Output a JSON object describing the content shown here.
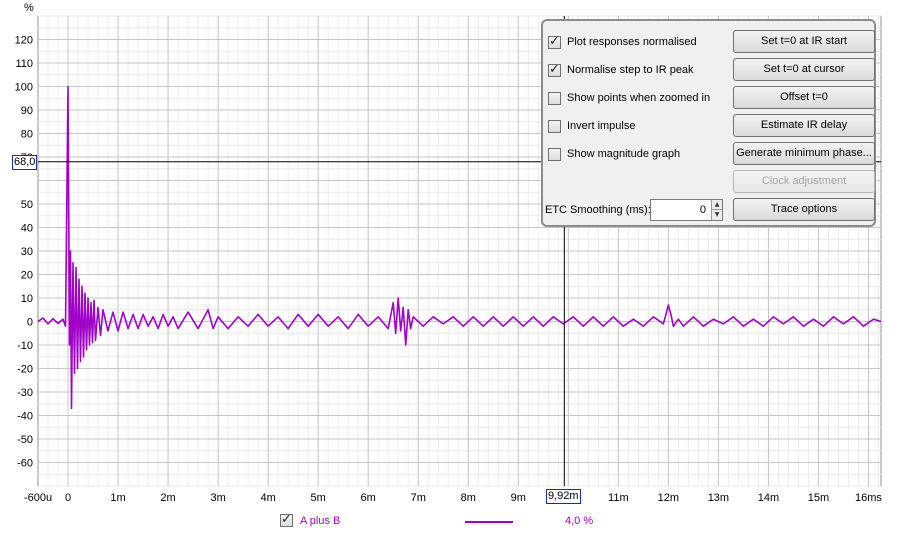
{
  "chart_data": {
    "type": "line",
    "ylabel": "%",
    "xlim_ms": [
      -0.6,
      16.25
    ],
    "ylim": [
      -70,
      130
    ],
    "x_ticks": [
      {
        "v": -0.6,
        "label": "-600u"
      },
      {
        "v": 0,
        "label": "0"
      },
      {
        "v": 1,
        "label": "1m"
      },
      {
        "v": 2,
        "label": "2m"
      },
      {
        "v": 3,
        "label": "3m"
      },
      {
        "v": 4,
        "label": "4m"
      },
      {
        "v": 5,
        "label": "5m"
      },
      {
        "v": 6,
        "label": "6m"
      },
      {
        "v": 7,
        "label": "7m"
      },
      {
        "v": 8,
        "label": "8m"
      },
      {
        "v": 9,
        "label": "9m"
      },
      {
        "v": 11,
        "label": "11m"
      },
      {
        "v": 12,
        "label": "12m"
      },
      {
        "v": 13,
        "label": "13m"
      },
      {
        "v": 14,
        "label": "14m"
      },
      {
        "v": 15,
        "label": "15m"
      },
      {
        "v": 16,
        "label": "16ms"
      }
    ],
    "y_ticks": [
      120,
      110,
      100,
      90,
      80,
      70,
      50,
      40,
      30,
      20,
      10,
      0,
      -10,
      -20,
      -30,
      -40,
      -50,
      -60
    ],
    "series": [
      {
        "name": "A plus B",
        "color": "#a100c8",
        "points": [
          [
            -0.6,
            0
          ],
          [
            -0.5,
            1.5
          ],
          [
            -0.4,
            -1
          ],
          [
            -0.3,
            1.2
          ],
          [
            -0.2,
            -0.8
          ],
          [
            -0.1,
            1
          ],
          [
            -0.05,
            -2
          ],
          [
            0,
            100
          ],
          [
            0.03,
            -10
          ],
          [
            0.05,
            30
          ],
          [
            0.07,
            -37
          ],
          [
            0.1,
            25
          ],
          [
            0.13,
            -22
          ],
          [
            0.16,
            23
          ],
          [
            0.19,
            -20
          ],
          [
            0.22,
            18
          ],
          [
            0.25,
            -17
          ],
          [
            0.28,
            15
          ],
          [
            0.31,
            -15
          ],
          [
            0.34,
            12
          ],
          [
            0.37,
            -12
          ],
          [
            0.4,
            10
          ],
          [
            0.43,
            -10
          ],
          [
            0.46,
            8
          ],
          [
            0.49,
            -9
          ],
          [
            0.52,
            9
          ],
          [
            0.55,
            -8
          ],
          [
            0.6,
            6
          ],
          [
            0.65,
            -6
          ],
          [
            0.7,
            5
          ],
          [
            0.8,
            -4
          ],
          [
            0.9,
            4
          ],
          [
            1.0,
            -4
          ],
          [
            1.1,
            4
          ],
          [
            1.2,
            -3
          ],
          [
            1.3,
            3
          ],
          [
            1.4,
            -3
          ],
          [
            1.5,
            3
          ],
          [
            1.6,
            -2
          ],
          [
            1.7,
            2
          ],
          [
            1.8,
            -3
          ],
          [
            1.9,
            3
          ],
          [
            2.0,
            -2
          ],
          [
            2.1,
            2
          ],
          [
            2.2,
            -3
          ],
          [
            2.4,
            4
          ],
          [
            2.6,
            -3
          ],
          [
            2.8,
            5
          ],
          [
            2.9,
            -3
          ],
          [
            3.0,
            2
          ],
          [
            3.2,
            -3
          ],
          [
            3.4,
            2
          ],
          [
            3.6,
            -2
          ],
          [
            3.8,
            3
          ],
          [
            4.0,
            -2
          ],
          [
            4.2,
            2
          ],
          [
            4.4,
            -3
          ],
          [
            4.6,
            3
          ],
          [
            4.8,
            -2
          ],
          [
            5.0,
            3
          ],
          [
            5.2,
            -2
          ],
          [
            5.4,
            2
          ],
          [
            5.6,
            -3
          ],
          [
            5.8,
            3
          ],
          [
            6.0,
            -2
          ],
          [
            6.2,
            2
          ],
          [
            6.4,
            -3
          ],
          [
            6.5,
            8
          ],
          [
            6.55,
            -5
          ],
          [
            6.6,
            10
          ],
          [
            6.65,
            -4
          ],
          [
            6.7,
            6
          ],
          [
            6.75,
            -10
          ],
          [
            6.8,
            5
          ],
          [
            6.85,
            -3
          ],
          [
            6.9,
            2
          ],
          [
            7.1,
            -2
          ],
          [
            7.3,
            2
          ],
          [
            7.5,
            -1
          ],
          [
            7.7,
            2
          ],
          [
            7.9,
            -2
          ],
          [
            8.1,
            2
          ],
          [
            8.3,
            -2
          ],
          [
            8.5,
            2
          ],
          [
            8.7,
            -2
          ],
          [
            8.9,
            2
          ],
          [
            9.1,
            -2
          ],
          [
            9.3,
            2
          ],
          [
            9.5,
            -2
          ],
          [
            9.7,
            2
          ],
          [
            9.9,
            -1
          ],
          [
            10.1,
            2
          ],
          [
            10.3,
            -2
          ],
          [
            10.5,
            2
          ],
          [
            10.7,
            -2
          ],
          [
            10.9,
            2
          ],
          [
            11.1,
            -2
          ],
          [
            11.3,
            1
          ],
          [
            11.5,
            -2
          ],
          [
            11.7,
            2
          ],
          [
            11.9,
            -1
          ],
          [
            12.0,
            7
          ],
          [
            12.05,
            3
          ],
          [
            12.1,
            -2
          ],
          [
            12.2,
            1
          ],
          [
            12.3,
            -2
          ],
          [
            12.5,
            2
          ],
          [
            12.7,
            -2
          ],
          [
            12.9,
            1
          ],
          [
            13.1,
            -1
          ],
          [
            13.3,
            2
          ],
          [
            13.5,
            -2
          ],
          [
            13.7,
            1
          ],
          [
            13.9,
            -2
          ],
          [
            14.1,
            2
          ],
          [
            14.3,
            -1
          ],
          [
            14.5,
            2
          ],
          [
            14.7,
            -2
          ],
          [
            14.9,
            1
          ],
          [
            15.1,
            -2
          ],
          [
            15.3,
            2
          ],
          [
            15.5,
            -1
          ],
          [
            15.7,
            2
          ],
          [
            15.9,
            -2
          ],
          [
            16.1,
            1
          ],
          [
            16.25,
            0
          ]
        ]
      }
    ],
    "cursor": {
      "x_ms": 9.92,
      "y": 68
    }
  },
  "cursor_labels": {
    "y": "68,0",
    "x": "9,92m"
  },
  "controls": {
    "checkboxes": [
      {
        "label": "Plot responses normalised",
        "checked": true
      },
      {
        "label": "Normalise step to IR peak",
        "checked": true
      },
      {
        "label": "Show points when zoomed in",
        "checked": false
      },
      {
        "label": "Invert impulse",
        "checked": false
      },
      {
        "label": "Show magnitude graph",
        "checked": false
      }
    ],
    "buttons": [
      {
        "label": "Set t=0 at IR start"
      },
      {
        "label": "Set t=0 at cursor"
      },
      {
        "label": "Offset t=0"
      },
      {
        "label": "Estimate IR delay"
      },
      {
        "label": "Generate minimum phase..."
      },
      {
        "label": "Clock adjustment",
        "disabled": true
      },
      {
        "label": "Trace options"
      }
    ],
    "smoothing_label": "ETC Smoothing (ms):",
    "smoothing_value": "0"
  },
  "legend": {
    "name": "A plus B",
    "checked": true,
    "value": "4,0 %",
    "color": "#a100c8"
  }
}
